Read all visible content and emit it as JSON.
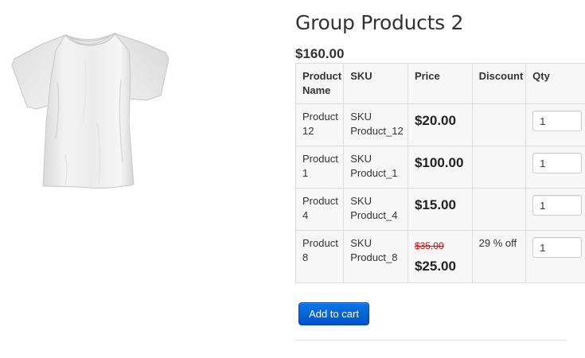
{
  "product": {
    "image_icon": "white-tshirt-icon",
    "title": "Group Products 2",
    "total_price": "$160.00"
  },
  "table": {
    "headers": {
      "name": "Product Name",
      "sku": "SKU",
      "price": "Price",
      "discount": "Discount",
      "qty": "Qty"
    },
    "rows": [
      {
        "name": "Product 12",
        "sku": "SKU Product_12",
        "old_price": "",
        "price": "$20.00",
        "discount": "",
        "qty": "1"
      },
      {
        "name": "Product 1",
        "sku": "SKU Product_1",
        "old_price": "",
        "price": "$100.00",
        "discount": "",
        "qty": "1"
      },
      {
        "name": "Product 4",
        "sku": "SKU Product_4",
        "old_price": "",
        "price": "$15.00",
        "discount": "",
        "qty": "1"
      },
      {
        "name": "Product 8",
        "sku": "SKU Product_8",
        "old_price": "$35.00",
        "price": "$25.00",
        "discount": "29 % off",
        "qty": "1"
      }
    ]
  },
  "actions": {
    "add_to_cart_label": "Add to cart"
  },
  "colors": {
    "button_primary": "#0a6fdf",
    "old_price_red": "#ee0000",
    "table_background": "#f7f7f7",
    "table_border": "#dddddd"
  }
}
